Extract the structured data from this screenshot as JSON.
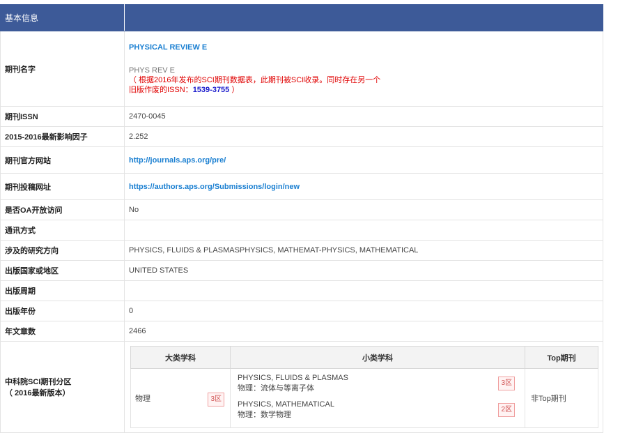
{
  "header": {
    "label": "基本信息"
  },
  "journal_name": {
    "label": "期刊名字",
    "title": "PHYSICAL REVIEW E",
    "abbrev": "PHYS REV E",
    "note_line1": "（ 根据2016年发布的SCI期刊数据表，此期刊被SCI收录。同时存在另一个",
    "note_line2_prefix": "旧版作废的ISSN：",
    "note_issn": "1539-3755",
    "note_line2_suffix": " ）"
  },
  "rows": {
    "issn": {
      "label": "期刊ISSN",
      "value": "2470-0045"
    },
    "impact": {
      "label": "2015-2016最新影响因子",
      "value": "2.252"
    },
    "website": {
      "label": "期刊官方网站",
      "value": "http://journals.aps.org/pre/"
    },
    "submit": {
      "label": "期刊投稿网址",
      "value": "https://authors.aps.org/Submissions/login/new"
    },
    "oa": {
      "label": "是否OA开放访问",
      "value": "No"
    },
    "contact": {
      "label": "通讯方式",
      "value": ""
    },
    "fields": {
      "label": "涉及的研究方向",
      "value": "PHYSICS, FLUIDS & PLASMASPHYSICS, MATHEMAT-PHYSICS, MATHEMATICAL"
    },
    "country": {
      "label": "出版国家或地区",
      "value": "UNITED STATES"
    },
    "period": {
      "label": "出版周期",
      "value": ""
    },
    "year": {
      "label": "出版年份",
      "value": "0"
    },
    "articles": {
      "label": "年文章数",
      "value": "2466"
    }
  },
  "cas": {
    "label_line1": "中科院SCI期刊分区",
    "label_line2": "（ 2016最新版本）",
    "headers": {
      "major": "大类学科",
      "minor": "小类学科",
      "top": "Top期刊"
    },
    "major_subject": "物理",
    "major_zone": "3区",
    "minor": [
      {
        "en": "PHYSICS, FLUIDS & PLASMAS",
        "cn": "物理：流体与等离子体",
        "zone": "3区"
      },
      {
        "en": "PHYSICS, MATHEMATICAL",
        "cn": "物理：数学物理",
        "zone": "2区"
      }
    ],
    "top_value": "非Top期刊"
  }
}
